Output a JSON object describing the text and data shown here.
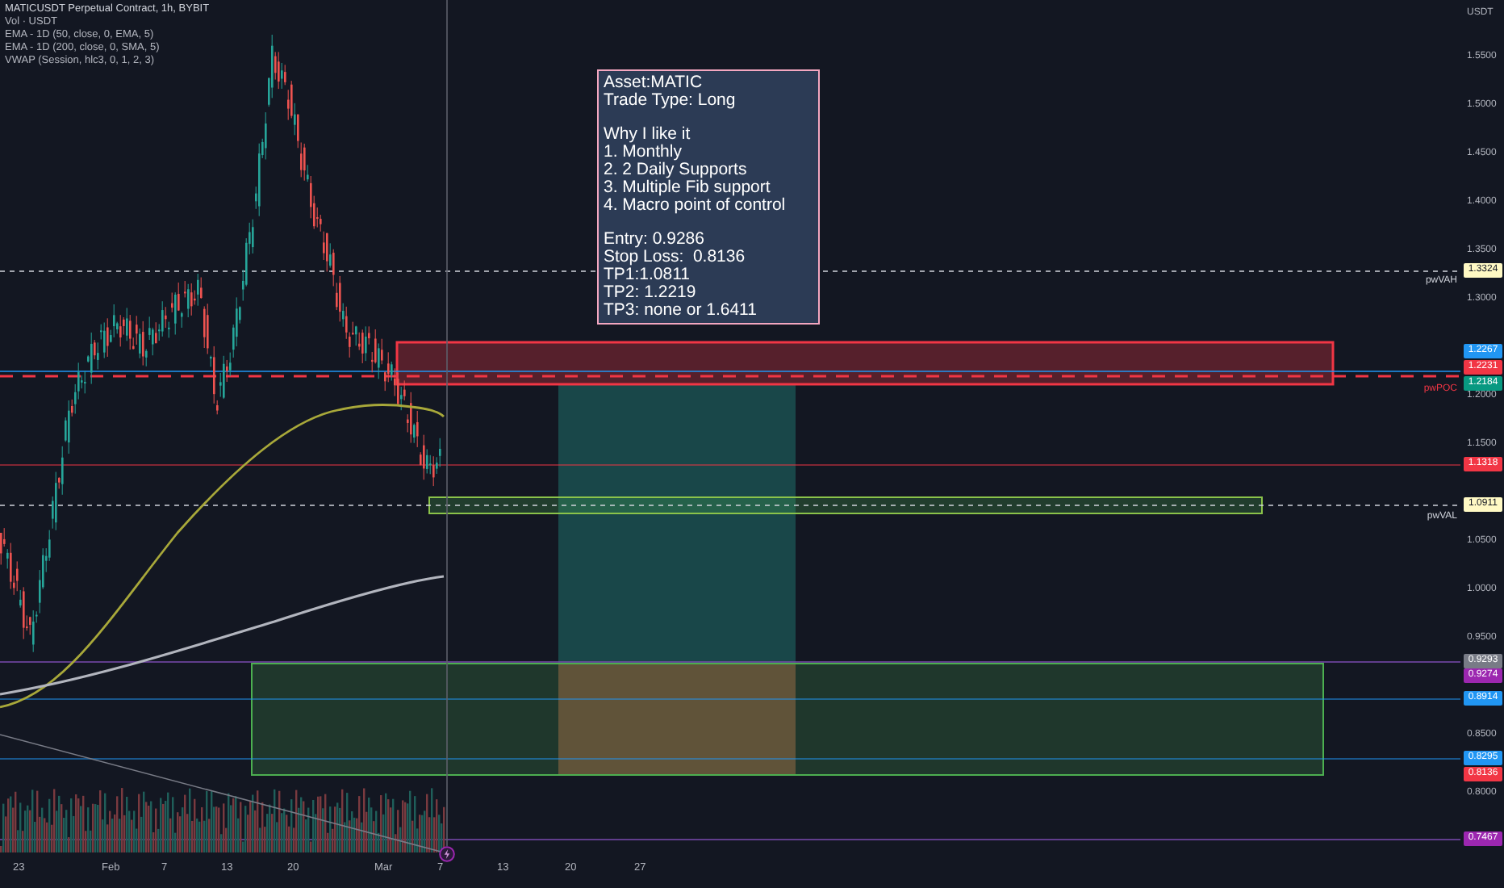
{
  "chart": {
    "legend": {
      "title": "MATICUSDT Perpetual Contract, 1h, BYBIT",
      "indicators": [
        "Vol · USDT",
        "EMA - 1D (50, close, 0, EMA, 5)",
        "EMA - 1D (200, close, 0, SMA, 5)",
        "VWAP (Session, hlc3, 0, 1, 2, 3)"
      ]
    },
    "note": {
      "paragraphs": [
        [
          "Asset:MATIC",
          "Trade Type: Long"
        ],
        [
          "Why I like it",
          "1. Monthly",
          "2. 2 Daily Supports",
          "3. Multiple Fib support",
          "4. Macro point of control"
        ],
        [
          "Entry: 0.9286",
          "Stop Loss:  0.8136",
          "TP1:1.0811",
          "TP2: 1.2219",
          "TP3: none or 1.6411"
        ]
      ]
    },
    "level_tags": [
      "pwVAH",
      "pwPOC",
      "pwVAL"
    ]
  },
  "price_axis": {
    "unit": "USDT",
    "ticks": [
      "1.5500",
      "1.5000",
      "1.4500",
      "1.4000",
      "1.3500",
      "1.3000",
      "1.2000",
      "1.1500",
      "1.0500",
      "1.0000",
      "0.9500",
      "0.8500",
      "0.8000"
    ],
    "labels": [
      {
        "text": "1.3324",
        "color": "#fff9c4"
      },
      {
        "text": "1.2267",
        "color": "#2196f3"
      },
      {
        "text": "1.2231",
        "color": "#f23645"
      },
      {
        "text": "1.2184",
        "color": "#089981"
      },
      {
        "text": "1.1318",
        "color": "#f23645"
      },
      {
        "text": "1.0911",
        "color": "#fff9c4"
      },
      {
        "text": "0.9293",
        "color": "#787b86"
      },
      {
        "text": "0.9274",
        "color": "#9c27b0"
      },
      {
        "text": "0.8914",
        "color": "#2196f3"
      },
      {
        "text": "0.8295",
        "color": "#2196f3"
      },
      {
        "text": "0.8136",
        "color": "#f23645"
      },
      {
        "text": "0.7467",
        "color": "#9c27b0"
      }
    ]
  },
  "time_axis": [
    "23",
    "Feb",
    "7",
    "13",
    "20",
    "Mar",
    "7",
    "13",
    "20",
    "27"
  ]
}
